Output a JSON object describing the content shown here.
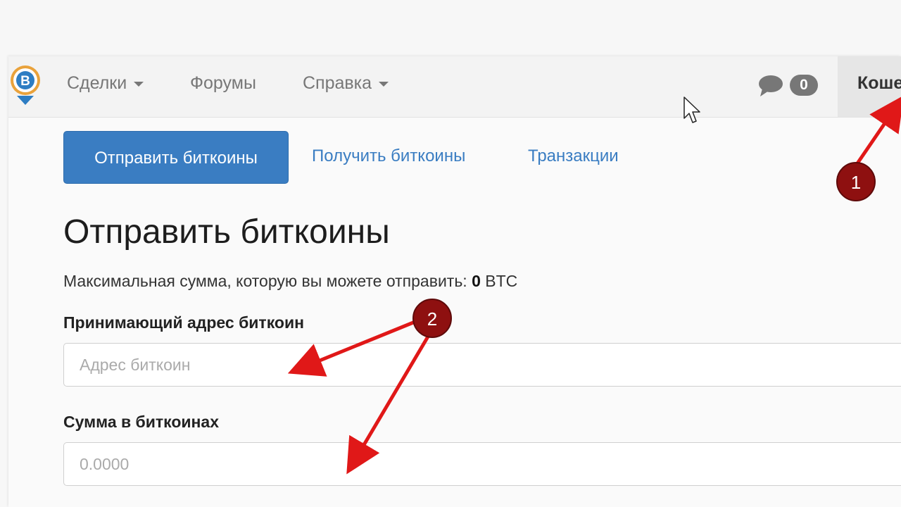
{
  "navbar": {
    "items": [
      {
        "label": "Сделки",
        "has_dropdown": true
      },
      {
        "label": "Форумы",
        "has_dropdown": false
      },
      {
        "label": "Справка",
        "has_dropdown": true
      }
    ],
    "message_count": "0",
    "wallet_label": "Кошелек"
  },
  "tabs": {
    "send": "Отправить биткоины",
    "receive": "Получить биткоины",
    "transactions": "Транзакции"
  },
  "page": {
    "title": "Отправить биткоины",
    "max_text_prefix": "Максимальная сумма, которую вы можете отправить: ",
    "max_amount": "0",
    "max_unit": " BTC"
  },
  "form": {
    "address_label": "Принимающий адрес биткоин",
    "address_placeholder": "Адрес биткоин",
    "amount_label": "Сумма в биткоинах",
    "amount_placeholder": "0.0000"
  },
  "annotations": {
    "marker1": "1",
    "marker2": "2"
  },
  "colors": {
    "primary": "#3a7dc2",
    "annotation_red": "#e01818",
    "marker_fill": "#8e1010"
  }
}
